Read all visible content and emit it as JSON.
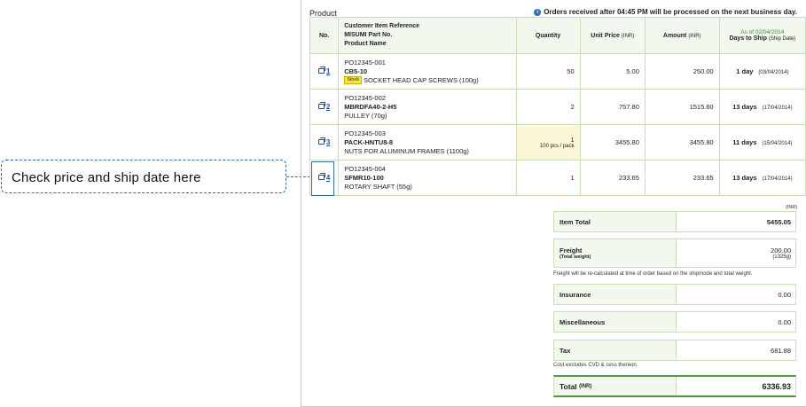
{
  "callout": {
    "text": "Check price and ship date here"
  },
  "product": {
    "section_title": "Product",
    "notice": "Orders received after 04:45 PM will be processed on the next business day.",
    "headers": {
      "no": "No.",
      "ref_line1": "Customer Item Reference",
      "ref_line2": "MISUMI Part No.",
      "ref_line3": "Product Name",
      "quantity": "Quantity",
      "unit_price": "Unit Price",
      "unit_price_unit": "(INR)",
      "amount": "Amount",
      "amount_unit": "(INR)",
      "as_of": "As of 02/04/2014",
      "days": "Days to Ship",
      "days_sub": "(Ship Date)"
    },
    "rows": [
      {
        "no": "1",
        "ref": "PO12345-001",
        "part": "CB5-10",
        "stock": "Stock",
        "name": "SOCKET HEAD CAP SCREWS (100g)",
        "qty": "50",
        "pack": "",
        "unit": "5.00",
        "amount": "250.00",
        "days": "1 day",
        "date": "(03/04/2014)"
      },
      {
        "no": "2",
        "ref": "PO12345-002",
        "part": "MBRDFA40-2-H5",
        "stock": "",
        "name": "PULLEY (70g)",
        "qty": "2",
        "pack": "",
        "unit": "757.80",
        "amount": "1515.60",
        "days": "13 days",
        "date": "(17/04/2014)"
      },
      {
        "no": "3",
        "ref": "PO12345-003",
        "part": "PACK-HNTU8-8",
        "stock": "",
        "name": "NUTS FOR ALUMINUM FRAMES (1100g)",
        "qty": "1",
        "pack": "100 pcs / pack",
        "unit": "3455.80",
        "amount": "3455.80",
        "days": "11 days",
        "date": "(15/04/2014)"
      },
      {
        "no": "4",
        "ref": "PO12345-004",
        "part": "SFMR10-100",
        "stock": "",
        "name": "ROTARY SHAFT (55g)",
        "qty": "1",
        "pack": "",
        "unit": "233.65",
        "amount": "233.65",
        "days": "13 days",
        "date": "(17/04/2014)"
      }
    ]
  },
  "totals": {
    "currency": "(INR)",
    "item_total_label": "Item Total",
    "item_total": "5455.05",
    "freight_label": "Freight",
    "freight_sub": "(Total weight)",
    "freight": "200.00",
    "weight": "(1325g)",
    "freight_note": "Freight will be re-calculated at time of order based on the shipmode and total weight.",
    "insurance_label": "Insurance",
    "insurance": "0.00",
    "misc_label": "Miscellaneous",
    "misc": "0.00",
    "tax_label": "Tax",
    "tax": "681.88",
    "tax_note": "Cost excludes CVD & cess thereon.",
    "total_label": "Total",
    "total_unit": "(INR)",
    "total": "6336.93"
  }
}
